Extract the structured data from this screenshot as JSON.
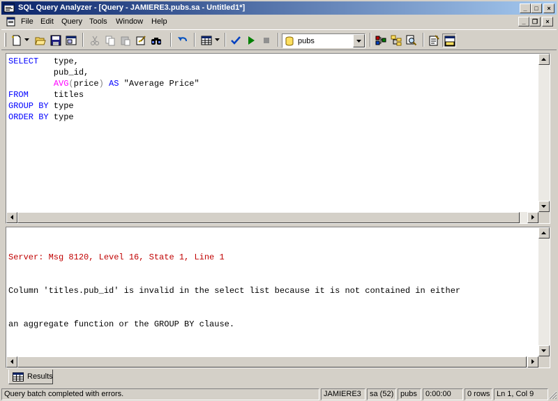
{
  "window": {
    "title": "SQL Query Analyzer - [Query - JAMIERE3.pubs.sa - Untitled1*]",
    "accent": "#0a246a"
  },
  "caption_buttons": {
    "minimize": "_",
    "maximize": "□",
    "close": "×"
  },
  "menu": {
    "items": [
      "File",
      "Edit",
      "Query",
      "Tools",
      "Window",
      "Help"
    ]
  },
  "mdi_buttons": {
    "minimize": "_",
    "restore": "❐",
    "close": "×"
  },
  "toolbar": {
    "buttons": [
      "new-query-icon",
      "open-icon",
      "save-icon",
      "insert-template-icon",
      "cut-icon",
      "copy-icon",
      "paste-icon",
      "clear-window-icon",
      "find-icon",
      "undo-icon",
      "results-mode-icon",
      "parse-query-icon",
      "execute-icon",
      "cancel-query-icon",
      "execution-plan-icon",
      "object-browser-icon",
      "object-search-icon",
      "properties-icon",
      "results-pane-icon"
    ],
    "database": "pubs"
  },
  "editor": {
    "lines": [
      [
        {
          "t": "SELECT",
          "c": "kw"
        },
        {
          "t": "   type,",
          "c": ""
        }
      ],
      [
        {
          "t": "         pub_id,",
          "c": ""
        }
      ],
      [
        {
          "t": "         ",
          "c": ""
        },
        {
          "t": "AVG",
          "c": "fn"
        },
        {
          "t": "(",
          "c": "gr"
        },
        {
          "t": "price",
          "c": ""
        },
        {
          "t": ")",
          "c": "gr"
        },
        {
          "t": " ",
          "c": ""
        },
        {
          "t": "AS",
          "c": "kw"
        },
        {
          "t": " \"Average Price\"",
          "c": ""
        }
      ],
      [
        {
          "t": "FROM",
          "c": "kw"
        },
        {
          "t": "     titles",
          "c": ""
        }
      ],
      [
        {
          "t": "GROUP BY",
          "c": "kw"
        },
        {
          "t": " type",
          "c": ""
        }
      ],
      [
        {
          "t": "ORDER BY",
          "c": "kw"
        },
        {
          "t": " type",
          "c": ""
        }
      ]
    ]
  },
  "results": {
    "error_header": "Server: Msg 8120, Level 16, State 1, Line 1",
    "message_line1": "Column 'titles.pub_id' is invalid in the select list because it is not contained in either",
    "message_line2": "an aggregate function or the GROUP BY clause."
  },
  "tabs": {
    "results_label": "Results"
  },
  "status": {
    "message": "Query batch completed with errors.",
    "server": "JAMIERE3",
    "user": "sa (52)",
    "database": "pubs",
    "elapsed": "0:00:00",
    "rows": "0 rows",
    "position": "Ln 1, Col 9"
  }
}
